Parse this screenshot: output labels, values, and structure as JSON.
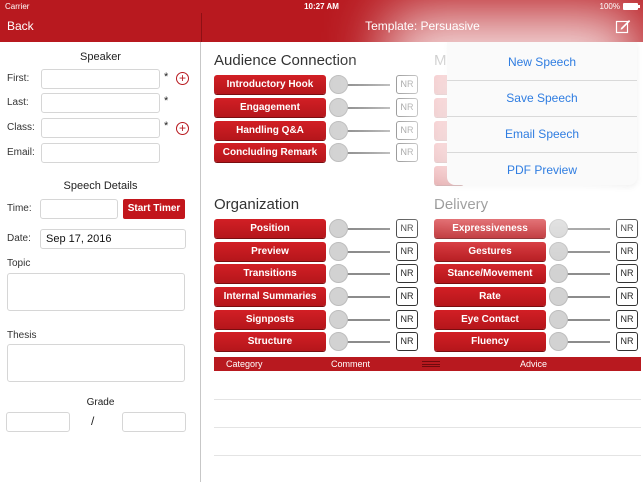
{
  "status": {
    "carrier": "Carrier",
    "time": "10:27 AM",
    "battery": "100%"
  },
  "nav": {
    "back_label": "Back",
    "title": "Template: Persuasive"
  },
  "speaker": {
    "title": "Speaker",
    "first_label": "First:",
    "last_label": "Last:",
    "class_label": "Class:",
    "email_label": "Email:",
    "required_mark": "*"
  },
  "details": {
    "title": "Speech Details",
    "time_label": "Time:",
    "start_timer_label": "Start Timer",
    "date_label": "Date:",
    "date_value": "Sep 17, 2016",
    "topic_label": "Topic",
    "thesis_label": "Thesis",
    "grade_label": "Grade",
    "grade_separator": "/"
  },
  "nr_label": "NR",
  "groups": {
    "audience": {
      "title": "Audience Connection",
      "items": [
        "Introductory Hook",
        "Engagement",
        "Handling Q&A",
        "Concluding Remark"
      ]
    },
    "hidden_title_fragment": "M",
    "organization": {
      "title": "Organization",
      "items": [
        "Position",
        "Preview",
        "Transitions",
        "Internal Summaries",
        "Signposts",
        "Structure"
      ]
    },
    "delivery": {
      "title": "Delivery",
      "items": [
        "Expressiveness",
        "Gestures",
        "Stance/Movement",
        "Rate",
        "Eye Contact",
        "Fluency"
      ]
    }
  },
  "table": {
    "col_category": "Category",
    "col_comment": "Comment",
    "col_advice": "Advice"
  },
  "popover": {
    "items": [
      "New Speech",
      "Save Speech",
      "Email Speech",
      "PDF Preview"
    ]
  },
  "colors": {
    "brand_red": "#b8191f",
    "link_blue": "#2f7de1"
  }
}
